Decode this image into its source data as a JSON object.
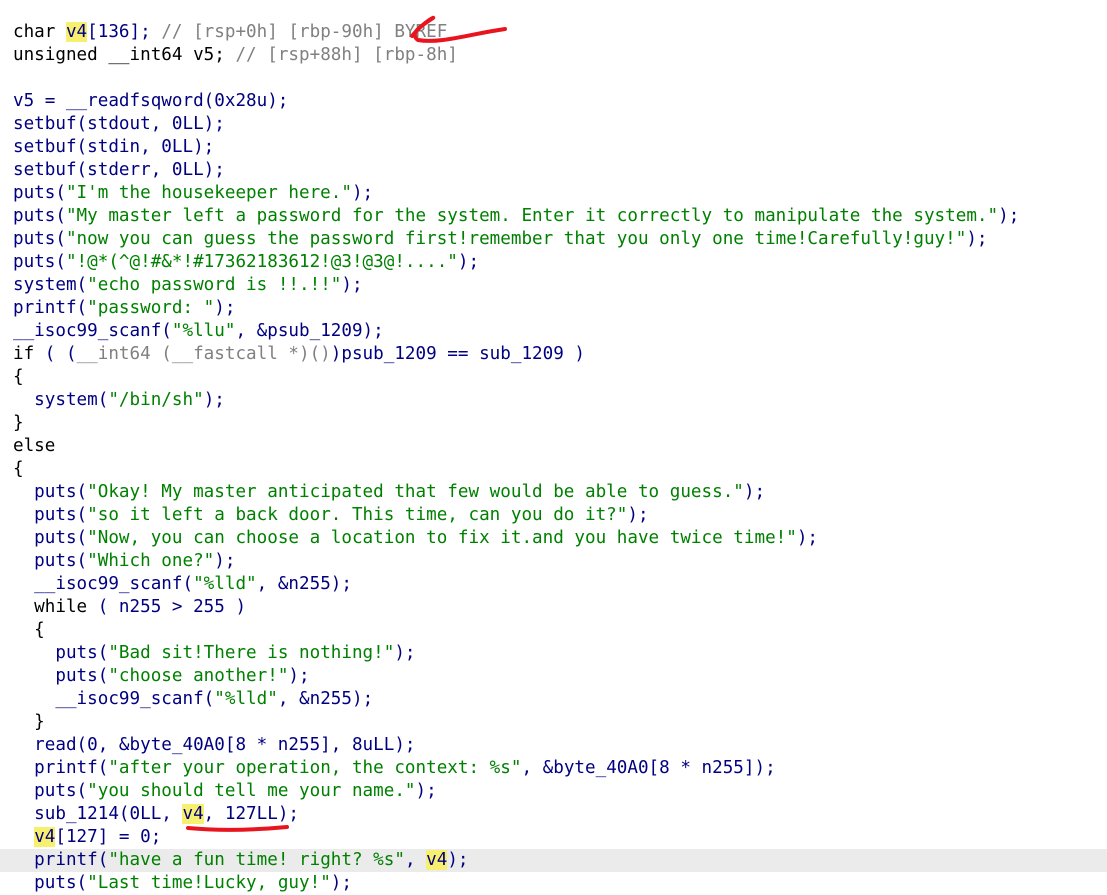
{
  "lines": [
    [
      {
        "t": "char ",
        "c": "t-type"
      },
      {
        "t": "v4",
        "c": "t-plain",
        "hl": true
      },
      {
        "t": "[136]; ",
        "c": "t-plain"
      },
      {
        "t": "// [rsp+0h] [rbp-90h] BYREF",
        "c": "t-cmt"
      }
    ],
    [
      {
        "t": "unsigned __int64 v5; ",
        "c": "t-type"
      },
      {
        "t": "// [rsp+88h] [rbp-8h]",
        "c": "t-cmt"
      }
    ],
    [],
    [
      {
        "t": "v5 = __readfsqword(0x28u);",
        "c": "t-plain"
      }
    ],
    [
      {
        "t": "setbuf(stdout, 0LL);",
        "c": "t-plain"
      }
    ],
    [
      {
        "t": "setbuf(stdin, 0LL);",
        "c": "t-plain"
      }
    ],
    [
      {
        "t": "setbuf(stderr, 0LL);",
        "c": "t-plain"
      }
    ],
    [
      {
        "t": "puts(",
        "c": "t-plain"
      },
      {
        "t": "\"I'm the housekeeper here.\"",
        "c": "t-str"
      },
      {
        "t": ");",
        "c": "t-plain"
      }
    ],
    [
      {
        "t": "puts(",
        "c": "t-plain"
      },
      {
        "t": "\"My master left a password for the system. Enter it correctly to manipulate the system.\"",
        "c": "t-str"
      },
      {
        "t": ");",
        "c": "t-plain"
      }
    ],
    [
      {
        "t": "puts(",
        "c": "t-plain"
      },
      {
        "t": "\"now you can guess the password first!remember that you only one time!Carefully!guy!\"",
        "c": "t-str"
      },
      {
        "t": ");",
        "c": "t-plain"
      }
    ],
    [
      {
        "t": "puts(",
        "c": "t-plain"
      },
      {
        "t": "\"!@*(^@!#&*!#17362183612!@3!@3@!....\"",
        "c": "t-str"
      },
      {
        "t": ");",
        "c": "t-plain"
      }
    ],
    [
      {
        "t": "system(",
        "c": "t-plain"
      },
      {
        "t": "\"echo password is !!.!!\"",
        "c": "t-str"
      },
      {
        "t": ");",
        "c": "t-plain"
      }
    ],
    [
      {
        "t": "printf(",
        "c": "t-plain"
      },
      {
        "t": "\"password: \"",
        "c": "t-str"
      },
      {
        "t": ");",
        "c": "t-plain"
      }
    ],
    [
      {
        "t": "__isoc99_scanf(",
        "c": "t-plain"
      },
      {
        "t": "\"%llu\"",
        "c": "t-str"
      },
      {
        "t": ", &psub_1209);",
        "c": "t-plain"
      }
    ],
    [
      {
        "t": "if",
        "c": "t-type"
      },
      {
        "t": " ( (",
        "c": "t-plain"
      },
      {
        "t": "__int64 (__fastcall *)()",
        "c": "t-gray"
      },
      {
        "t": ")psub_1209 == sub_1209 )",
        "c": "t-plain"
      }
    ],
    [
      {
        "t": "{",
        "c": "t-type"
      }
    ],
    [
      {
        "t": "  system(",
        "c": "t-plain"
      },
      {
        "t": "\"/bin/sh\"",
        "c": "t-str"
      },
      {
        "t": ");",
        "c": "t-plain"
      }
    ],
    [
      {
        "t": "}",
        "c": "t-type"
      }
    ],
    [
      {
        "t": "else",
        "c": "t-type"
      }
    ],
    [
      {
        "t": "{",
        "c": "t-type"
      }
    ],
    [
      {
        "t": "  puts(",
        "c": "t-plain"
      },
      {
        "t": "\"Okay! My master anticipated that few would be able to guess.\"",
        "c": "t-str"
      },
      {
        "t": ");",
        "c": "t-plain"
      }
    ],
    [
      {
        "t": "  puts(",
        "c": "t-plain"
      },
      {
        "t": "\"so it left a back door. This time, can you do it?\"",
        "c": "t-str"
      },
      {
        "t": ");",
        "c": "t-plain"
      }
    ],
    [
      {
        "t": "  puts(",
        "c": "t-plain"
      },
      {
        "t": "\"Now, you can choose a location to fix it.and you have twice time!\"",
        "c": "t-str"
      },
      {
        "t": ");",
        "c": "t-plain"
      }
    ],
    [
      {
        "t": "  puts(",
        "c": "t-plain"
      },
      {
        "t": "\"Which one?\"",
        "c": "t-str"
      },
      {
        "t": ");",
        "c": "t-plain"
      }
    ],
    [
      {
        "t": "  __isoc99_scanf(",
        "c": "t-plain"
      },
      {
        "t": "\"%lld\"",
        "c": "t-str"
      },
      {
        "t": ", &n255);",
        "c": "t-plain"
      }
    ],
    [
      {
        "t": "  while",
        "c": "t-type"
      },
      {
        "t": " ( n255 > 255 )",
        "c": "t-plain"
      }
    ],
    [
      {
        "t": "  {",
        "c": "t-type"
      }
    ],
    [
      {
        "t": "    puts(",
        "c": "t-plain"
      },
      {
        "t": "\"Bad sit!There is nothing!\"",
        "c": "t-str"
      },
      {
        "t": ");",
        "c": "t-plain"
      }
    ],
    [
      {
        "t": "    puts(",
        "c": "t-plain"
      },
      {
        "t": "\"choose another!\"",
        "c": "t-str"
      },
      {
        "t": ");",
        "c": "t-plain"
      }
    ],
    [
      {
        "t": "    __isoc99_scanf(",
        "c": "t-plain"
      },
      {
        "t": "\"%lld\"",
        "c": "t-str"
      },
      {
        "t": ", &n255);",
        "c": "t-plain"
      }
    ],
    [
      {
        "t": "  }",
        "c": "t-type"
      }
    ],
    [
      {
        "t": "  read(0, &byte_40A0[8 * n255], 8uLL);",
        "c": "t-plain"
      }
    ],
    [
      {
        "t": "  printf(",
        "c": "t-plain"
      },
      {
        "t": "\"after your operation, the context: %s\"",
        "c": "t-str"
      },
      {
        "t": ", &byte_40A0[8 * n255]);",
        "c": "t-plain"
      }
    ],
    [
      {
        "t": "  puts(",
        "c": "t-plain"
      },
      {
        "t": "\"you should tell me your name.\"",
        "c": "t-str"
      },
      {
        "t": ");",
        "c": "t-plain"
      }
    ],
    [
      {
        "t": "  sub_1214(0LL, ",
        "c": "t-plain"
      },
      {
        "t": "v4",
        "c": "t-plain",
        "hl": true
      },
      {
        "t": ", 127LL);",
        "c": "t-plain"
      }
    ],
    [
      {
        "t": "  ",
        "c": "t-plain"
      },
      {
        "t": "v4",
        "c": "t-plain",
        "hl": true
      },
      {
        "t": "[127] = 0;",
        "c": "t-plain"
      }
    ],
    [
      {
        "t": "  printf(",
        "c": "t-plain"
      },
      {
        "t": "\"have a fun time! right? %s\"",
        "c": "t-str"
      },
      {
        "t": ", ",
        "c": "t-plain"
      },
      {
        "t": "v4",
        "c": "t-plain",
        "hl": true
      },
      {
        "t": ");",
        "c": "t-plain"
      }
    ],
    [
      {
        "t": "  puts(",
        "c": "t-plain"
      },
      {
        "t": "\"Last time!Lucky, guy!\"",
        "c": "t-str"
      },
      {
        "t": ");",
        "c": "t-plain"
      }
    ]
  ],
  "current_line": 36,
  "colors": {
    "highlight": "#f7ef6e",
    "annotation": "#e8141e",
    "string": "#008000",
    "comment": "#808080",
    "identifier": "#000080"
  }
}
